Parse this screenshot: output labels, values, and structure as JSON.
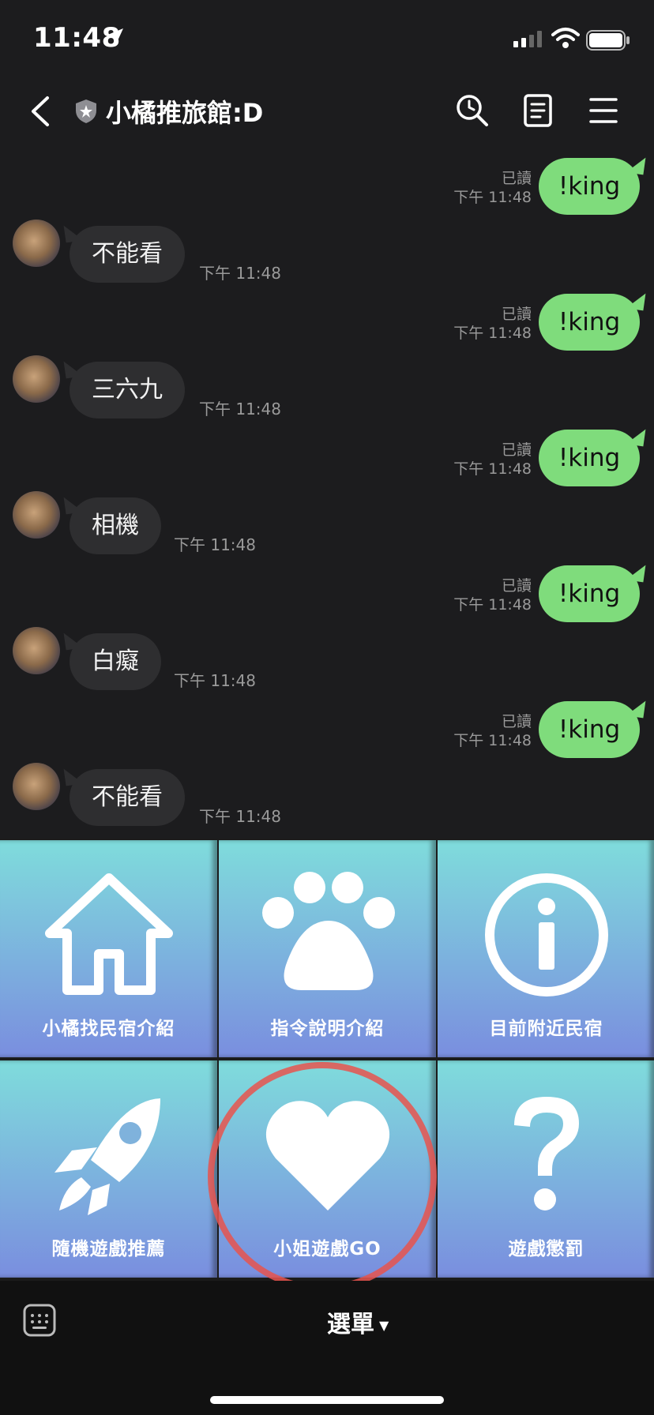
{
  "status_bar": {
    "time": "11:48"
  },
  "header": {
    "title": "小橘推旅館:D"
  },
  "messages": [
    {
      "dir": "out",
      "text": "!king",
      "read": "已讀",
      "time": "下午 11:48"
    },
    {
      "dir": "in",
      "text": "不能看",
      "time": "下午 11:48"
    },
    {
      "dir": "out",
      "text": "!king",
      "read": "已讀",
      "time": "下午 11:48"
    },
    {
      "dir": "in",
      "text": "三六九",
      "time": "下午 11:48"
    },
    {
      "dir": "out",
      "text": "!king",
      "read": "已讀",
      "time": "下午 11:48"
    },
    {
      "dir": "in",
      "text": "相機",
      "time": "下午 11:48"
    },
    {
      "dir": "out",
      "text": "!king",
      "read": "已讀",
      "time": "下午 11:48"
    },
    {
      "dir": "in",
      "text": "白癡",
      "time": "下午 11:48"
    },
    {
      "dir": "out",
      "text": "!king",
      "read": "已讀",
      "time": "下午 11:48"
    },
    {
      "dir": "in",
      "text": "不能看",
      "time": "下午 11:48"
    }
  ],
  "rich_menu": {
    "tiles": [
      {
        "label": "小橘找民宿介紹",
        "icon": "house-icon"
      },
      {
        "label": "指令說明介紹",
        "icon": "paw-icon"
      },
      {
        "label": "目前附近民宿",
        "icon": "info-icon"
      },
      {
        "label": "隨機遊戲推薦",
        "icon": "rocket-icon"
      },
      {
        "label": "小姐遊戲GO",
        "icon": "heart-icon"
      },
      {
        "label": "遊戲懲罰",
        "icon": "question-icon"
      }
    ]
  },
  "bottom_bar": {
    "menu_label": "選單"
  },
  "colors": {
    "outgoing_bubble": "#7fdc7c",
    "incoming_bubble": "#2e2e30",
    "highlight": "#e8534e"
  }
}
